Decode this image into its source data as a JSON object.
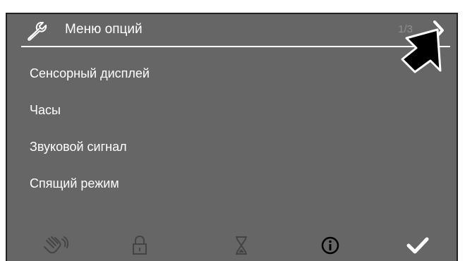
{
  "header": {
    "title": "Меню опций",
    "page_indicator": "1/3",
    "icon": "wrench-icon",
    "next_icon": "chevron-right-icon"
  },
  "menu": {
    "items": [
      {
        "label": "Сенсорный дисплей"
      },
      {
        "label": "Часы"
      },
      {
        "label": "Звуковой сигнал"
      },
      {
        "label": "Спящий режим"
      }
    ]
  },
  "footer": {
    "buttons": [
      {
        "icon": "hand-wave-icon"
      },
      {
        "icon": "lock-icon"
      },
      {
        "icon": "hourglass-icon"
      },
      {
        "icon": "info-icon"
      },
      {
        "icon": "checkmark-icon"
      }
    ]
  },
  "colors": {
    "background": "#666666",
    "text": "#ffffff",
    "muted_text": "#8f8f8f"
  }
}
